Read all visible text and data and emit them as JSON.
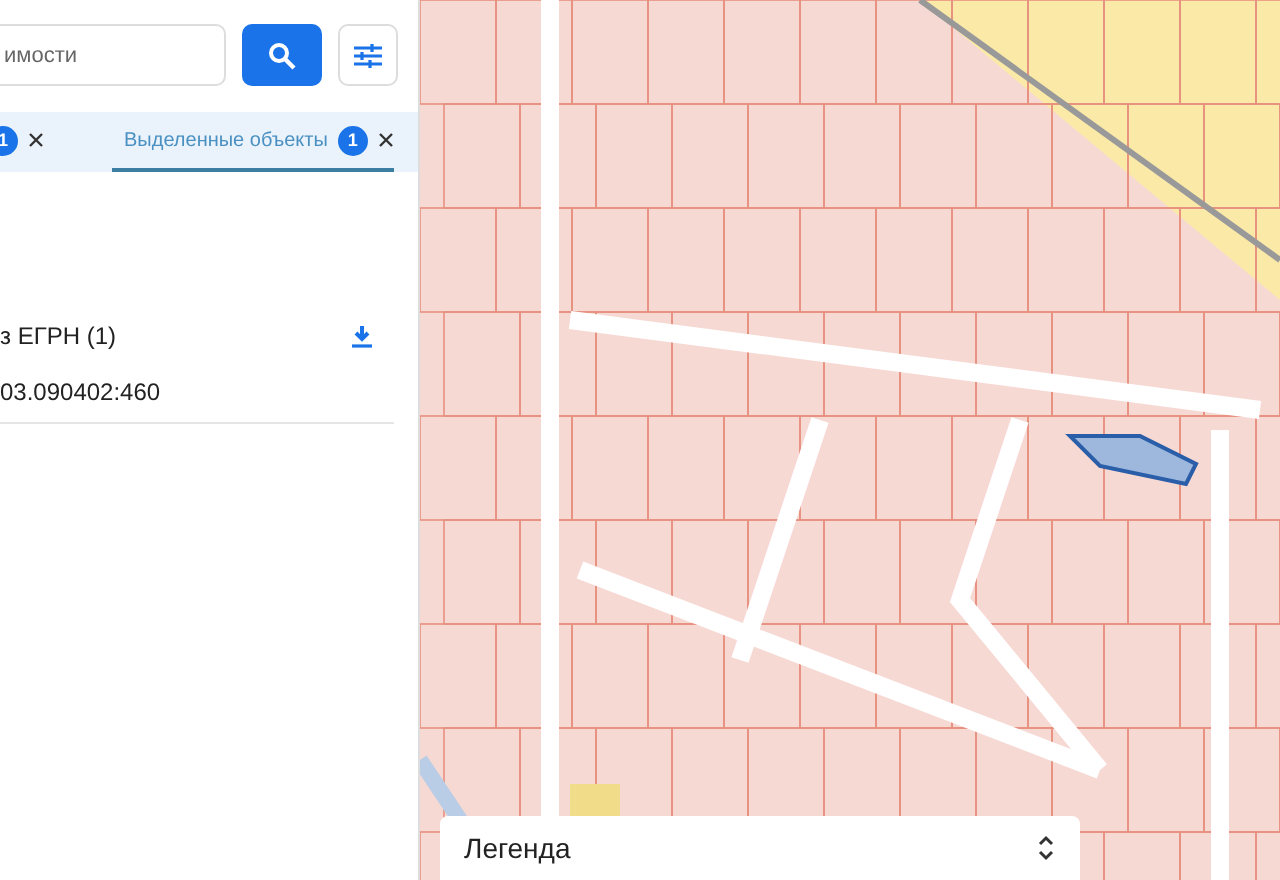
{
  "search": {
    "placeholder": "имости"
  },
  "tabs": [
    {
      "count": "1",
      "selected": false
    },
    {
      "label": "Выделенные объекты",
      "count": "1",
      "selected": true
    }
  ],
  "results": {
    "title": "з ЕГРН (1)",
    "items": [
      "03.090402:460"
    ]
  },
  "legend": {
    "title": "Легенда"
  }
}
